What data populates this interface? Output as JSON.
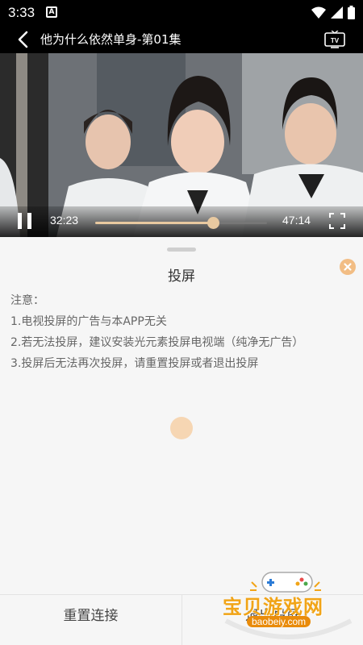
{
  "status_bar": {
    "time": "3:33",
    "notification_letter": "A"
  },
  "header": {
    "title": "他为什么依然单身-第01集",
    "tv_label": "TV"
  },
  "player": {
    "current_time": "32:23",
    "total_time": "47:14",
    "progress": 0.685
  },
  "cast_sheet": {
    "title": "投屏",
    "notes": [
      "注意：",
      "1.电视投屏的广告与本APP无关",
      "2.若无法投屏，建议安装光元素投屏电视端（纯净无广告）",
      "3.投屏后无法再次投屏，请重置投屏或者退出投屏"
    ]
  },
  "bottom_bar": {
    "left_label": "重置连接",
    "right_label": "退出投屏"
  },
  "watermark": {
    "text": "宝贝游戏网",
    "url": "baobeiy.com"
  },
  "colors": {
    "accent": "#e8c9a0",
    "close": "#f2bd84",
    "background": "#f6f6f6"
  }
}
